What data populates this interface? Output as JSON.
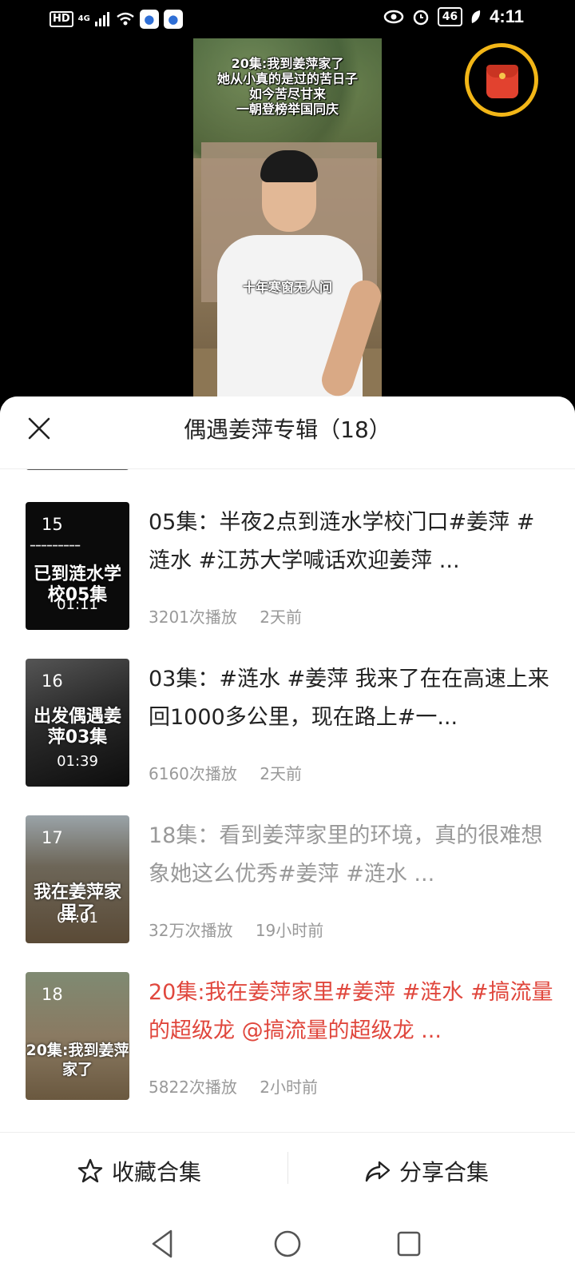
{
  "status_bar": {
    "hd": "HD",
    "network": "4G",
    "battery": "46",
    "time": "4:11"
  },
  "video": {
    "caption_lines": [
      "20集:我到姜萍家了",
      "她从小真的是过的苦日子",
      "如今苦尽甘来",
      "一朝登榜举国同庆"
    ],
    "subtitle": "十年寒窗无人问"
  },
  "sheet": {
    "title": "偶遇姜萍专辑（18）"
  },
  "episodes": [
    {
      "index": "15",
      "thumb_title": "已到涟水学校05集",
      "duration": "01:11",
      "title": "05集：半夜2点到涟水学校门口#姜萍 #涟水 #江苏大学喊话欢迎姜萍 ...",
      "plays": "3201次播放",
      "time": "2天前",
      "state": "normal"
    },
    {
      "index": "16",
      "thumb_title": "出发偶遇姜萍03集",
      "duration": "01:39",
      "title": "03集：#涟水 #姜萍 我来了在在高速上来回1000多公里，现在路上#一...",
      "plays": "6160次播放",
      "time": "2天前",
      "state": "normal"
    },
    {
      "index": "17",
      "thumb_title": "我在姜萍家里了",
      "duration": "04:01",
      "title": "18集：看到姜萍家里的环境，真的很难想象她这么优秀#姜萍 #涟水 ...",
      "plays": "32万次播放",
      "time": "19小时前",
      "state": "watched"
    },
    {
      "index": "18",
      "thumb_title": "20集:我到姜萍家了",
      "duration": "",
      "title": "20集:我在姜萍家里#姜萍 #涟水 #搞流量的超级龙 @搞流量的超级龙 ...",
      "plays": "5822次播放",
      "time": "2小时前",
      "state": "current"
    }
  ],
  "actions": {
    "collect": "收藏合集",
    "share": "分享合集"
  },
  "colors": {
    "accent_red": "#e0473d",
    "watched_gray": "#999999",
    "ring_gold": "#f2b617"
  }
}
